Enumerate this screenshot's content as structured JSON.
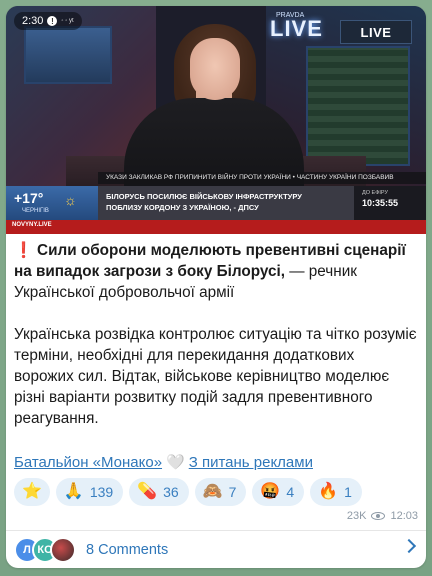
{
  "status_bar": {
    "time": "2:30",
    "alert": "!",
    "extra": "◦ ◦ yt"
  },
  "video": {
    "live_text": "LIVE",
    "live_sub": "PRAVDA",
    "channel_logo": "LIVE",
    "ticker": "УКАЗИ ЗАКЛИКАВ РФ ПРИПИНИТИ ВІЙНУ ПРОТИ УКРАЇНИ • ЧАСТИНУ УКРАЇНИ ПОЗБАВИВ",
    "temperature": "+17°",
    "city": "ЧЕРНІГІВ",
    "headline_line1": "БІЛОРУСЬ ПОСИЛЮЄ ВІЙСЬКОВУ ІНФРАСТРУКТУРУ",
    "headline_line2": "ПОБЛИЗУ КОРДОНУ З УКРАЇНОЮ, - ДПСУ",
    "clock_label": "ДО ЕФІРУ",
    "clock_time": "10:35:55",
    "site": "NOVYNY.LIVE"
  },
  "message": {
    "bang": "❗",
    "bold_text": "Сили оборони моделюють превентивні сценарії на випадок загрози з боку Білорусі,",
    "rest_text": " — речник Української добровольчої армії",
    "paragraph2": "Українська розвідка контролює ситуацію та чітко розуміє терміни, необхідні для перекидання додаткових ворожих сил. Відтак, військове керівництво моделює різні варіанти розвитку подій задля превентивного реагування."
  },
  "links": {
    "channel": "Батальйон «Монако»",
    "heart": "🤍",
    "ads": "З питань реклами"
  },
  "reactions": [
    {
      "emoji": "⭐",
      "icon": "star",
      "count": ""
    },
    {
      "emoji": "🙏",
      "icon": "pray",
      "count": "139"
    },
    {
      "emoji": "💊",
      "icon": "pill",
      "count": "36"
    },
    {
      "emoji": "🙈",
      "icon": "monkey",
      "count": "7"
    },
    {
      "emoji": "🤬",
      "icon": "angry",
      "count": "4"
    },
    {
      "emoji": "🔥",
      "icon": "fire",
      "count": "1"
    }
  ],
  "meta": {
    "views": "23K",
    "time": "12:03"
  },
  "comments": {
    "avatars": [
      "Л",
      "КО",
      ""
    ],
    "label": "8 Comments"
  },
  "colors": {
    "accent": "#2f77b9",
    "reaction_bg": "#e5f0f9",
    "alert_red": "#e02323",
    "background": "#7fa88a"
  }
}
